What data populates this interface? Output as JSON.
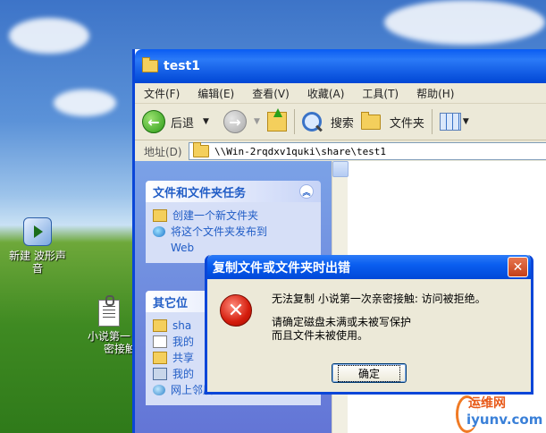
{
  "desktop": {
    "icons": [
      {
        "label_line1": "新建 波形声",
        "label_line2": "音"
      },
      {
        "label_line1": "小说第一",
        "label_line2": "密接触"
      }
    ]
  },
  "window": {
    "title": "test1",
    "menu": [
      "文件(F)",
      "编辑(E)",
      "查看(V)",
      "收藏(A)",
      "工具(T)",
      "帮助(H)"
    ],
    "toolbar": {
      "back": "后退",
      "search": "搜索",
      "folders": "文件夹"
    },
    "address": {
      "label": "地址(D)",
      "value": "\\\\Win-2rqdxv1quki\\share\\test1"
    },
    "left_pane": {
      "tasks_title": "文件和文件夹任务",
      "tasks": [
        "创建一个新文件夹",
        "将这个文件夹发布到",
        "Web"
      ],
      "other_title": "其它位",
      "other_places": [
        "sha",
        "我的",
        "共享",
        "我的",
        "网上邻居"
      ]
    }
  },
  "dialog": {
    "title": "复制文件或文件夹时出错",
    "message1": "无法复制 小说第一次亲密接触: 访问被拒绝。",
    "message2": "请确定磁盘未满或未被写保护",
    "message3": "而且文件未被使用。",
    "ok_label": "确定",
    "close_glyph": "✕",
    "error_glyph": "✕"
  },
  "watermark": {
    "brand": "运维网",
    "url": "iyunv.com"
  },
  "icons": {
    "back": "back-arrow-icon",
    "forward": "forward-arrow-icon",
    "up": "folder-up-icon",
    "search": "search-icon",
    "folders": "folders-icon",
    "views": "views-icon",
    "error": "error-icon"
  }
}
